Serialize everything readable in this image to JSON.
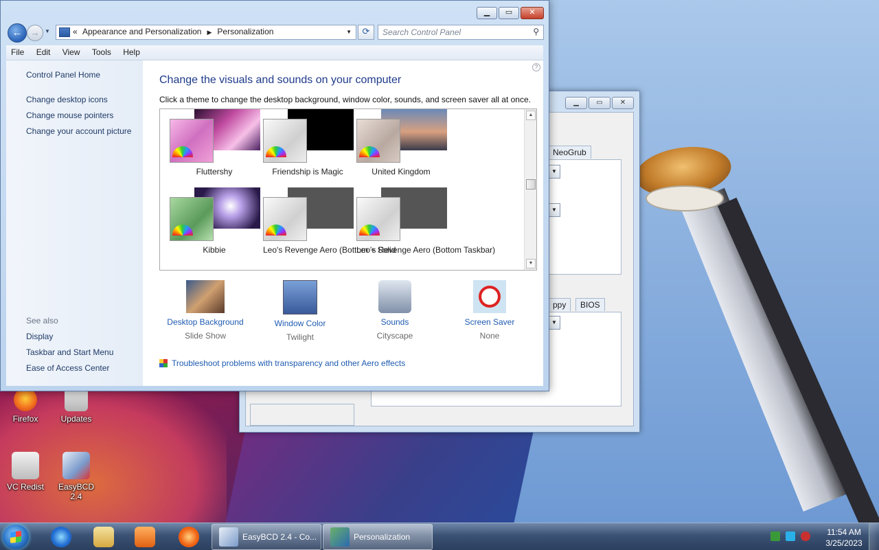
{
  "window": {
    "breadcrumb": [
      "Appearance and Personalization",
      "Personalization"
    ],
    "search_placeholder": "Search Control Panel",
    "menu": [
      "File",
      "Edit",
      "View",
      "Tools",
      "Help"
    ]
  },
  "sidebar": {
    "home": "Control Panel Home",
    "links": [
      "Change desktop icons",
      "Change mouse pointers",
      "Change your account picture"
    ],
    "see_also_title": "See also",
    "see_also": [
      "Display",
      "Taskbar and Start Menu",
      "Ease of Access Center"
    ]
  },
  "main": {
    "heading": "Change the visuals and sounds on your computer",
    "subheading": "Click a theme to change the desktop background, window color, sounds, and screen saver all at once.",
    "themes": [
      {
        "name": "Fluttershy"
      },
      {
        "name": "Friendship is Magic"
      },
      {
        "name": "United Kingdom"
      },
      {
        "name": "Kibbie"
      },
      {
        "name": "Leo's Revenge Aero (Bottom + Solid"
      },
      {
        "name": "Leo's Revenge Aero (Bottom Taskbar)"
      }
    ],
    "options": [
      {
        "label": "Desktop Background",
        "value": "Slide Show"
      },
      {
        "label": "Window Color",
        "value": "Twilight"
      },
      {
        "label": "Sounds",
        "value": "Cityscape"
      },
      {
        "label": "Screen Saver",
        "value": "None"
      }
    ],
    "troubleshoot": "Troubleshoot problems with transparency and other Aero effects"
  },
  "background_window": {
    "tabs": [
      "NeoGrub",
      "ppy",
      "BIOS"
    ]
  },
  "desktop_icons": [
    "Firefox",
    "Updates",
    "VC Redist",
    "EasyBCD 2.4"
  ],
  "taskbar": {
    "tasks": [
      "EasyBCD 2.4 - Co...",
      "Personalization"
    ],
    "time": "11:54 AM",
    "date": "3/25/2023"
  }
}
